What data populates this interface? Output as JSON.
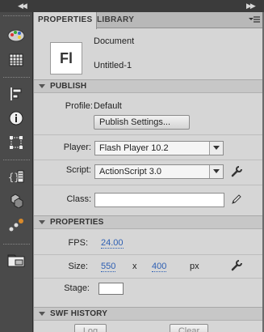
{
  "window": {
    "collapse_left": "◀◀",
    "collapse_right": "▶▶"
  },
  "tabs": [
    {
      "label": "PROPERTIES"
    },
    {
      "label": "LIBRARY"
    }
  ],
  "document": {
    "icon_text": "Fl",
    "type": "Document",
    "name": "Untitled-1"
  },
  "publish": {
    "title": "PUBLISH",
    "profile_label": "Profile:",
    "profile_value": "Default",
    "settings_button": "Publish Settings...",
    "player_label": "Player:",
    "player_value": "Flash Player 10.2",
    "script_label": "Script:",
    "script_value": "ActionScript 3.0",
    "class_label": "Class:",
    "class_value": ""
  },
  "properties": {
    "title": "PROPERTIES",
    "fps_label": "FPS:",
    "fps_value": "24.00",
    "size_label": "Size:",
    "width_value": "550",
    "x_sep": "x",
    "height_value": "400",
    "unit": "px",
    "stage_label": "Stage:",
    "stage_color": "#ffffff"
  },
  "swf_history": {
    "title": "SWF HISTORY",
    "log_button": "Log",
    "clear_button": "Clear"
  },
  "icons": {
    "menu": "panel-menu-icon",
    "wrench": "wrench-icon",
    "pencil": "pencil-icon"
  }
}
